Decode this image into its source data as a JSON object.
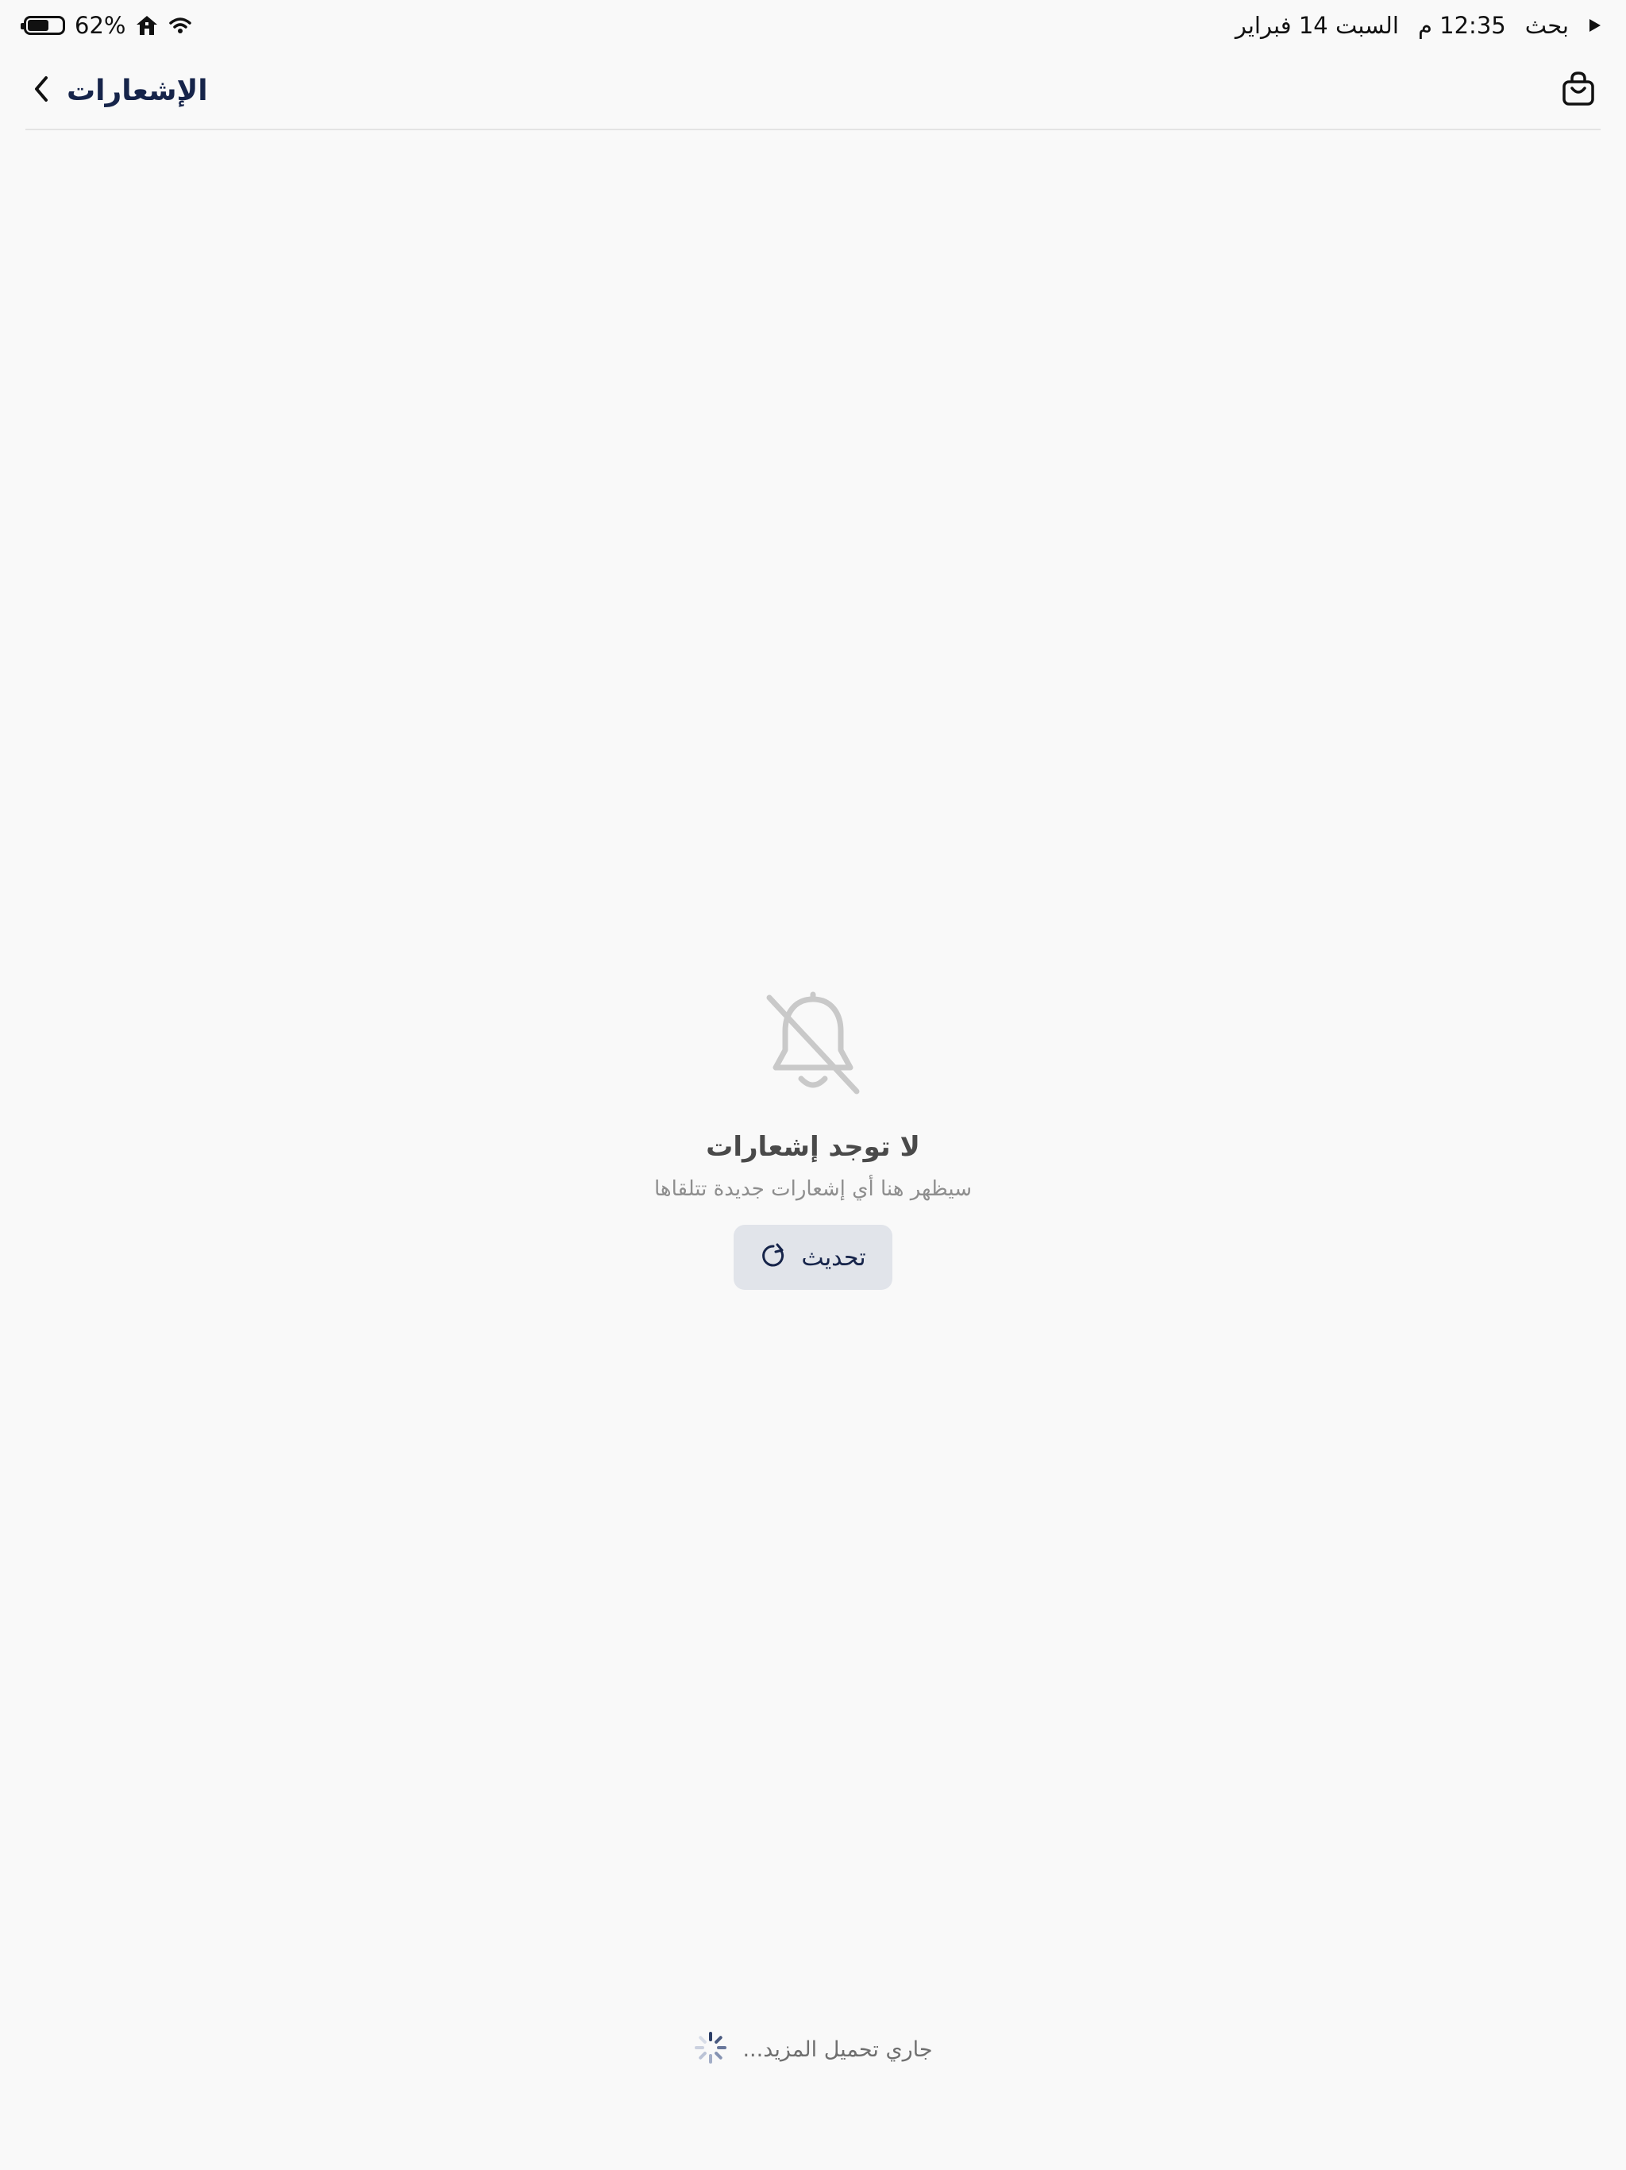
{
  "status_bar": {
    "back_label": "بحث",
    "time": "12:35 م",
    "date": "السبت 14 فبراير",
    "battery_percent_text": "62%",
    "battery_level": 0.62
  },
  "nav": {
    "title": "الإشعارات"
  },
  "empty_state": {
    "title": "لا توجد إشعارات",
    "subtitle": "سيظهر هنا أي إشعارات جديدة تتلقاها",
    "refresh_label": "تحديث"
  },
  "footer": {
    "loading_label": "جاري تحميل المزيد..."
  },
  "icons": {
    "status_back": "play-arrow-icon",
    "home": "home-icon",
    "wifi": "wifi-icon",
    "battery": "battery-icon",
    "chevron": "chevron-left-icon",
    "bag": "shopping-bag-icon",
    "bell_off": "bell-off-icon",
    "refresh": "refresh-icon",
    "spinner": "spinner-icon"
  },
  "colors": {
    "navy": "#16244a",
    "background": "#f9f9f9",
    "button_bg": "#e1e4ea"
  }
}
